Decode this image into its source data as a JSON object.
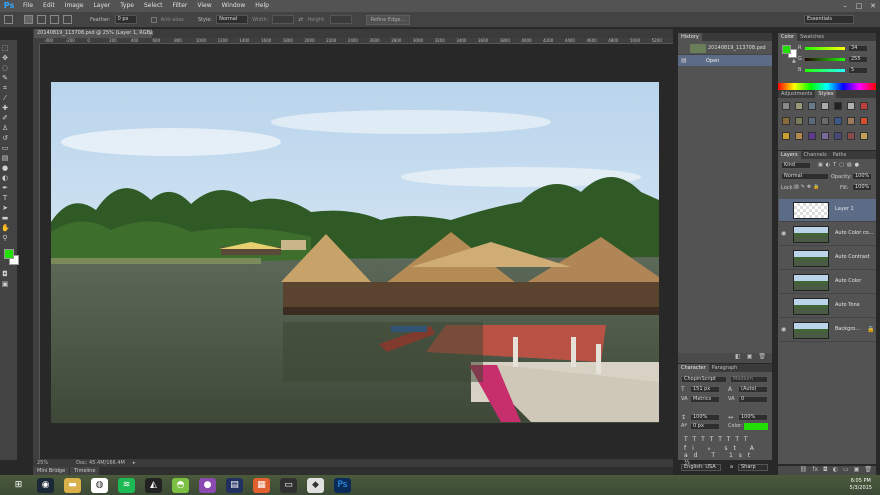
{
  "app": {
    "logo": "Ps"
  },
  "menu": [
    "File",
    "Edit",
    "Image",
    "Layer",
    "Type",
    "Select",
    "Filter",
    "View",
    "Window",
    "Help"
  ],
  "window_controls": [
    "–",
    "□",
    "✕"
  ],
  "options_bar": {
    "feather_label": "Feather:",
    "feather_value": "0 px",
    "antialias_label": "Anti-alias",
    "style_label": "Style:",
    "style_value": "Normal",
    "width_label": "Width:",
    "height_label": "Height:",
    "refine_button": "Refine Edge...",
    "workspace": "Essentials"
  },
  "document": {
    "tab_title": "20140819_113708.psd @ 25% (Layer 1, RGB/8) *",
    "zoom": "25%",
    "doc_size": "Doc: 45.4M/166.4M",
    "ruler_marks": [
      "-400",
      "-200",
      "0",
      "200",
      "400",
      "600",
      "800",
      "1000",
      "1200",
      "1400",
      "1600",
      "1800",
      "2000",
      "2200",
      "2400",
      "2600",
      "2800",
      "3000",
      "3200",
      "3400",
      "3600",
      "3800",
      "4000",
      "4200",
      "4400",
      "4600",
      "4800",
      "5000",
      "5200"
    ]
  },
  "bottom_tabs": [
    "Mini Bridge",
    "Timeline"
  ],
  "history": {
    "tab": "History",
    "snapshot": "20140819_113708.psd",
    "state": "Open"
  },
  "color_panel": {
    "tabs": [
      "Color",
      "Swatches"
    ],
    "r": "34",
    "g": "255",
    "b": "5",
    "foreground": "#22e005",
    "background": "#ffffff"
  },
  "adjust_panel": {
    "tabs": [
      "Adjustments",
      "Styles"
    ]
  },
  "layers_panel": {
    "tabs": [
      "Layers",
      "Channels",
      "Paths"
    ],
    "kind": "Kind",
    "blend_mode": "Normal",
    "opacity_label": "Opacity:",
    "opacity": "100%",
    "lock_label": "Lock:",
    "fill_label": "Fill:",
    "fill": "100%",
    "layers": [
      "Layer 1",
      "Auto Color co...",
      "Auto Contrast",
      "Auto Color",
      "Auto Tone",
      "Backgro..."
    ]
  },
  "character_panel": {
    "tabs": [
      "Character",
      "Paragraph"
    ],
    "font_family": "ChopinScript",
    "font_style": "Medium",
    "font_size": "151 px",
    "leading": "(Auto)",
    "kerning": "Metrics",
    "tracking": "0",
    "vscale": "100%",
    "hscale": "100%",
    "baseline": "0 px",
    "color_label": "Color:",
    "text_color": "#22e005",
    "language": "English: USA",
    "aa_label": "a",
    "aa_value": "Sharp"
  },
  "taskbar": {
    "icons": [
      "windows-start-icon",
      "steam-icon",
      "file-explorer-icon",
      "chrome-icon",
      "spotify-icon",
      "unity-icon",
      "android-icon",
      "purple-app-icon",
      "notepad-icon",
      "grid-app-icon",
      "terminal-icon",
      "inkscape-icon",
      "photoshop-icon"
    ],
    "time": "6:05 PM",
    "date": "5/3/2015"
  }
}
